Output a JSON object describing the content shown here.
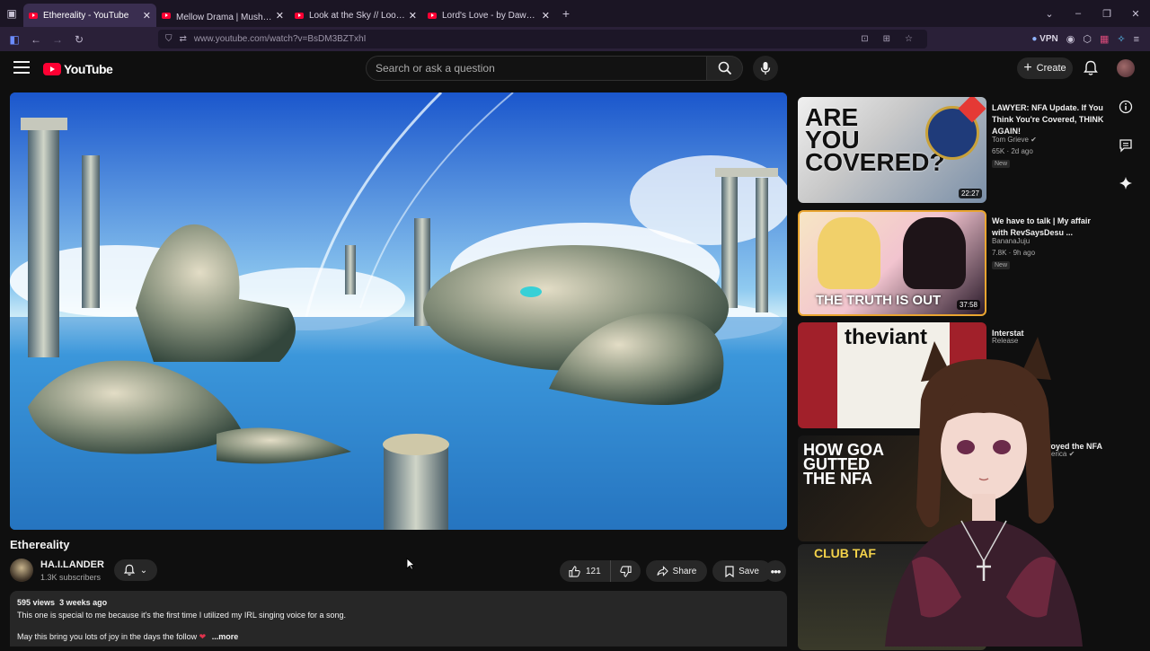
{
  "browser": {
    "tabs": [
      {
        "title": "Ethereality - YouTube",
        "active": true
      },
      {
        "title": "Mellow Drama | Mushi (AMV) (Ⓓ",
        "active": false
      },
      {
        "title": "Look at the Sky // Look at the S",
        "active": false
      },
      {
        "title": "Lord's Love - by DawnHalo - Yo",
        "active": false
      }
    ],
    "url": "www.youtube.com/watch?v=BsDM3BZTxhI",
    "vpn_label": "VPN"
  },
  "header": {
    "logo_text": "YouTube",
    "search_placeholder": "Search or ask a question",
    "create_label": "Create"
  },
  "video": {
    "title": "Ethereality",
    "channel_name": "HA.I.LANDER",
    "subscribers": "1.3K subscribers",
    "likes": "121",
    "share_label": "Share",
    "save_label": "Save"
  },
  "description": {
    "views": "595 views",
    "age": "3 weeks ago",
    "line1": "This one is special to me because it's the first time I utilized my IRL singing voice for a song.",
    "line2": "May this bring you lots of joy in the days the follow",
    "more_label": "...more"
  },
  "recommendations": [
    {
      "title": "LAWYER: NFA Update. If You Think You're Covered, THINK AGAIN!",
      "channel": "Tom Grieve",
      "meta": "65K · 2d ago",
      "badge": "New",
      "duration": "22:27",
      "thumb_text": "ARE YOU COVERED?"
    },
    {
      "title": "We have to talk | My affair with RevSaysDesu ...",
      "channel": "BananaJuju",
      "meta": "7.8K · 9h ago",
      "badge": "New",
      "duration": "37:58",
      "thumb_text": "THE TRUTH IS OUT"
    },
    {
      "title": "Interstat",
      "channel": "Release",
      "meta": "",
      "badge": "",
      "duration": "",
      "thumb_text": "theviant"
    },
    {
      "title": "stroyed the NFA",
      "channel": "America",
      "meta": "",
      "badge": "",
      "duration": "",
      "thumb_text": "HOW GOA GUTTED THE NFA"
    },
    {
      "title": "",
      "channel": "",
      "meta": "",
      "badge": "",
      "duration": "",
      "thumb_text": "CLUB TAF"
    }
  ],
  "colors": {
    "accent_red": "#ff0033",
    "background": "#0f0f0f",
    "pill": "#272727",
    "tab_active": "#3a2e50"
  }
}
